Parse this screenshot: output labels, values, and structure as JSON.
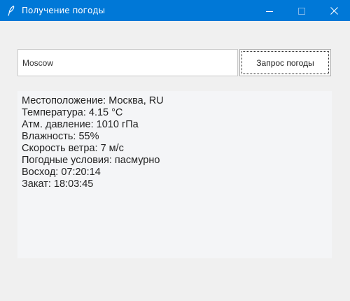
{
  "window": {
    "title": "Получение погоды",
    "icon": "feather-icon",
    "controls": [
      "minimize-icon",
      "maximize-icon",
      "close-icon"
    ]
  },
  "colors": {
    "titlebar": "#0078d7",
    "background": "#f0f0f0",
    "panel": "#f4f5f7"
  },
  "form": {
    "city_value": "Moscow",
    "button_label": "Запрос погоды"
  },
  "result": {
    "lines": [
      "Местоположение: Москва, RU",
      "Температура: 4.15 °C",
      "Атм. давление: 1010 гПа",
      "Влажность: 55%",
      "Скорость ветра: 7 м/с",
      "Погодные условия: пасмурно",
      "Восход: 07:20:14",
      "Закат: 18:03:45"
    ]
  }
}
